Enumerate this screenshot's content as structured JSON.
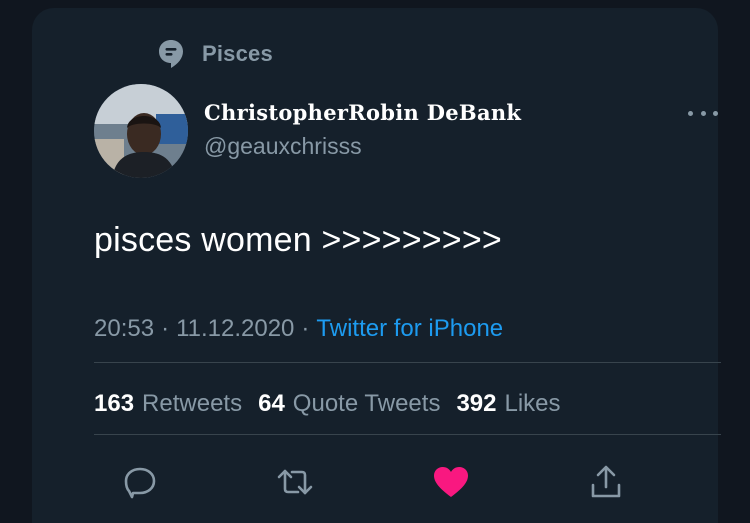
{
  "topic": {
    "label": "Pisces",
    "icon": "topic-tag-icon"
  },
  "author": {
    "display_name": "ChristopherRobin DeBank",
    "handle": "@geauxchrisss",
    "avatar": "profile-photo"
  },
  "tweet": {
    "text": "pisces women >>>>>>>>>"
  },
  "meta": {
    "time": "20:53",
    "sep1": "·",
    "date": "11.12.2020",
    "sep2": "·",
    "source": "Twitter for iPhone"
  },
  "stats": {
    "retweets": {
      "count": "163",
      "label": "Retweets"
    },
    "quotes": {
      "count": "64",
      "label": "Quote Tweets"
    },
    "likes": {
      "count": "392",
      "label": "Likes"
    }
  },
  "actions": {
    "reply": "reply-icon",
    "retweet": "retweet-icon",
    "like": "heart-icon",
    "share": "share-icon"
  },
  "colors": {
    "background": "#15202b",
    "secondary_text": "#8899a6",
    "link": "#1d9bf0",
    "like": "#f91880",
    "divider": "#38444d"
  }
}
